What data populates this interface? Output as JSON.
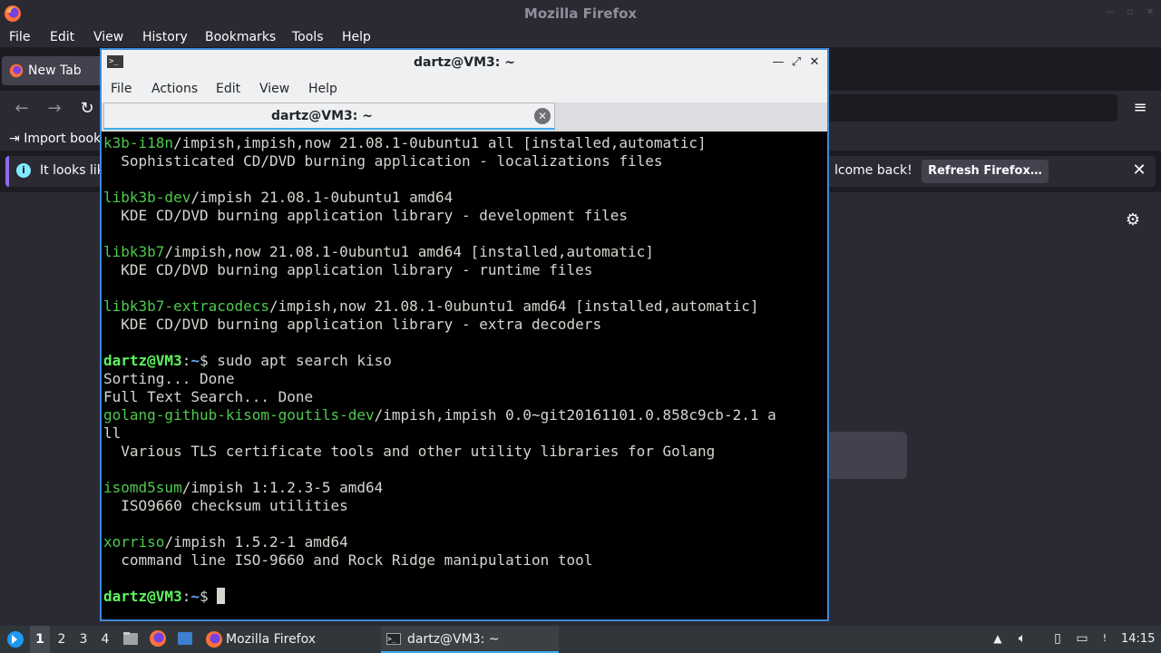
{
  "firefox": {
    "window_title": "Mozilla Firefox",
    "menu": [
      "File",
      "Edit",
      "View",
      "History",
      "Bookmarks",
      "Tools",
      "Help"
    ],
    "tab_label": "New Tab",
    "bookmarks_import": "Import book",
    "notification_left": "It looks lik",
    "notification_right": "lcome back!",
    "refresh_button": "Refresh Firefox…",
    "icons": {
      "logo": "firefox-logo-icon",
      "back": "arrow-left-icon",
      "forward": "arrow-right-icon",
      "reload": "reload-icon",
      "menu": "hamburger-icon",
      "info": "info-icon",
      "close": "close-icon",
      "settings": "gear-icon"
    }
  },
  "terminal": {
    "window_title": "dartz@VM3: ~",
    "menu": [
      "File",
      "Actions",
      "Edit",
      "View",
      "Help"
    ],
    "tab_label": "dartz@VM3: ~",
    "lines": [
      {
        "pkg": "k3b-i18n",
        "rest": "/impish,impish,now 21.08.1-0ubuntu1 all [installed,automatic]"
      },
      {
        "text": "  Sophisticated CD/DVD burning application - localizations files"
      },
      {
        "text": ""
      },
      {
        "pkg": "libk3b-dev",
        "rest": "/impish 21.08.1-0ubuntu1 amd64"
      },
      {
        "text": "  KDE CD/DVD burning application library - development files"
      },
      {
        "text": ""
      },
      {
        "pkg": "libk3b7",
        "rest": "/impish,now 21.08.1-0ubuntu1 amd64 [installed,automatic]"
      },
      {
        "text": "  KDE CD/DVD burning application library - runtime files"
      },
      {
        "text": ""
      },
      {
        "pkg": "libk3b7-extracodecs",
        "rest": "/impish,now 21.08.1-0ubuntu1 amd64 [installed,automatic]"
      },
      {
        "text": "  KDE CD/DVD burning application library - extra decoders"
      },
      {
        "text": ""
      },
      {
        "prompt": true,
        "cmd": " sudo apt search kiso"
      },
      {
        "text": "Sorting... Done"
      },
      {
        "text": "Full Text Search... Done"
      },
      {
        "pkg": "golang-github-kisom-goutils-dev",
        "rest": "/impish,impish 0.0~git20161101.0.858c9cb-2.1 a"
      },
      {
        "text": "ll"
      },
      {
        "text": "  Various TLS certificate tools and other utility libraries for Golang"
      },
      {
        "text": ""
      },
      {
        "pkg": "isomd5sum",
        "rest": "/impish 1:1.2.3-5 amd64"
      },
      {
        "text": "  ISO9660 checksum utilities"
      },
      {
        "text": ""
      },
      {
        "pkg": "xorriso",
        "rest": "/impish 1.5.2-1 amd64"
      },
      {
        "text": "  command line ISO-9660 and Rock Ridge manipulation tool"
      },
      {
        "text": ""
      },
      {
        "prompt": true,
        "cmd": " ",
        "cursor": true
      }
    ],
    "prompt_user": "dartz@VM3",
    "prompt_sep": ":",
    "prompt_path": "~",
    "prompt_sign": "$"
  },
  "taskbar": {
    "workspaces": [
      "1",
      "2",
      "3",
      "4"
    ],
    "active_workspace": "1",
    "tasks": [
      "Mozilla Firefox",
      "dartz@VM3: ~"
    ],
    "clock": "14:15"
  }
}
